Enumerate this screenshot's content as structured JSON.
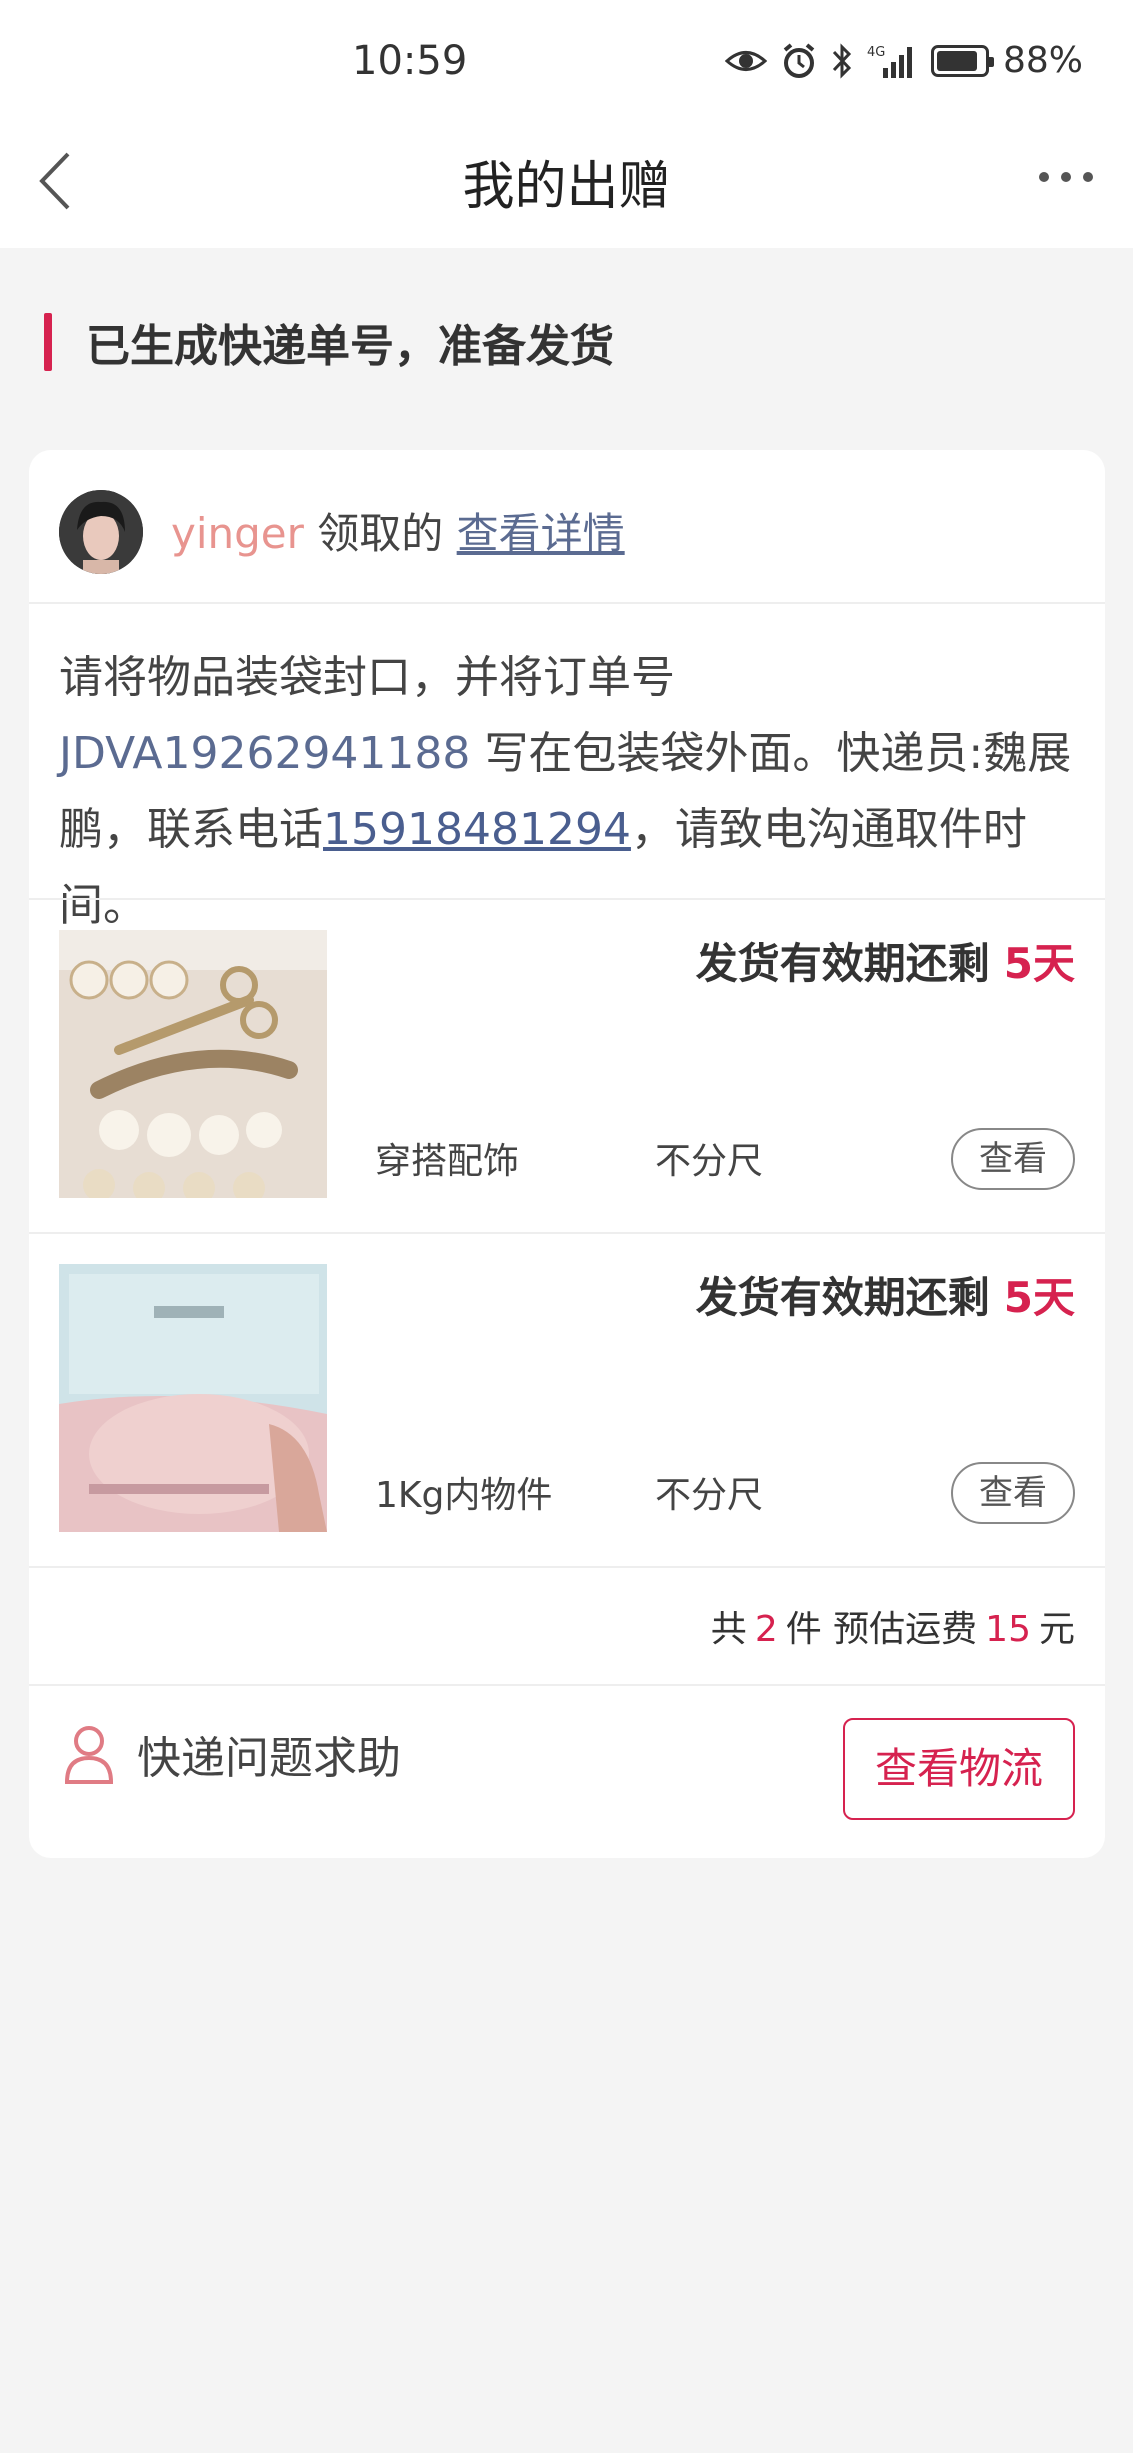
{
  "status_bar": {
    "time": "10:59",
    "battery_level": 0.88,
    "battery_text": "88%"
  },
  "nav": {
    "title": "我的出赠"
  },
  "status": {
    "heading": "已生成快递单号，准备发货"
  },
  "claimer": {
    "name": "yinger",
    "verb": "领取的",
    "link": "查看详情"
  },
  "instruction": {
    "part1": "请将物品装袋封口，并将订单号 ",
    "order_no": "JDVA19262941188",
    "part2": " 写在包装袋外面。快递员:魏展鹏，联系电话",
    "phone": "15918481294",
    "part3": "，请致电沟通取件时间。"
  },
  "items": [
    {
      "deadline_label": "发货有效期还剩",
      "days": "5天",
      "category": "穿搭配饰",
      "size": "不分尺",
      "view_label": "查看",
      "thumb_icon": "hair-clips-photo"
    },
    {
      "deadline_label": "发货有效期还剩",
      "days": "5天",
      "category": "1Kg内物件",
      "size": "不分尺",
      "view_label": "查看",
      "thumb_icon": "package-bag-photo"
    }
  ],
  "summary": {
    "prefix": "共",
    "count": "2",
    "unit": "件 预估运费",
    "fee": "15",
    "currency": "元"
  },
  "help": {
    "label": "快递问题求助",
    "icon": "person-icon"
  },
  "logistics_button": "查看物流",
  "colors": {
    "accent": "#d6224f",
    "link": "#5b6b91",
    "name": "#e8948f",
    "background": "#f4f4f4"
  }
}
